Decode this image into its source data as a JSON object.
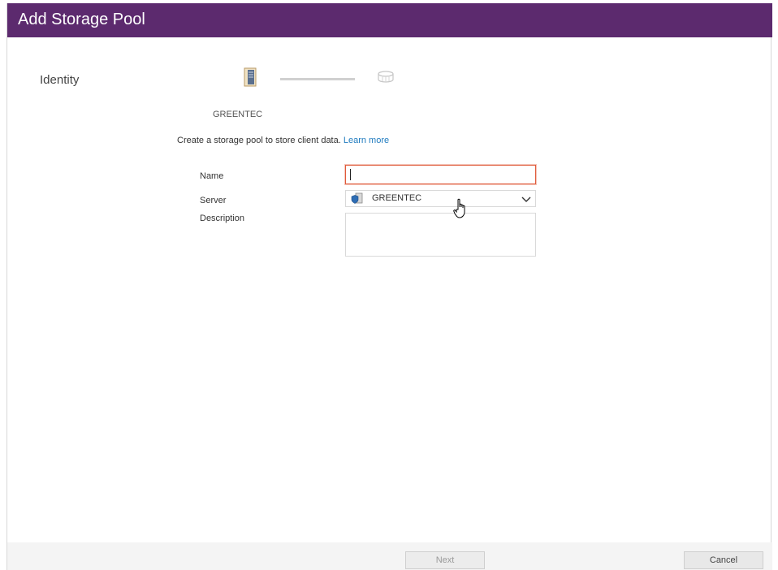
{
  "window": {
    "title": "Add Storage Pool"
  },
  "wizard": {
    "step_label": "Identity",
    "server_name": "GREENTEC",
    "intro_text": "Create a storage pool to store client data.",
    "learn_more": "Learn more",
    "step_icons": [
      "server-icon",
      "storage-pool-icon"
    ]
  },
  "form": {
    "name_label": "Name",
    "name_value": "",
    "server_label": "Server",
    "server_value": "GREENTEC",
    "server_icon": "server-shield-icon",
    "description_label": "Description",
    "description_value": ""
  },
  "footer": {
    "next_label": "Next",
    "cancel_label": "Cancel"
  },
  "colors": {
    "title_bar": "#5c2a6e",
    "link": "#1f7bbf",
    "focus_border": "#e05a3a"
  }
}
